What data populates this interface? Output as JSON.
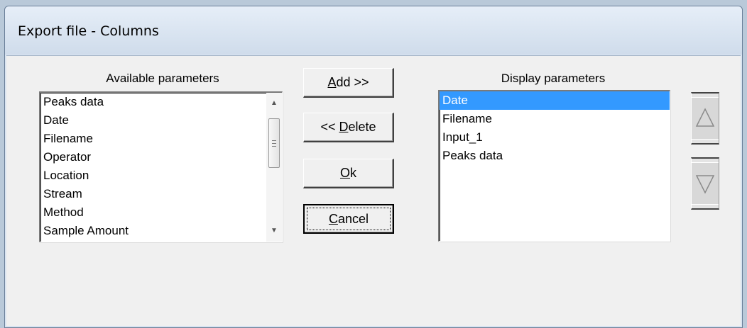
{
  "window": {
    "title": "Export file - Columns"
  },
  "available": {
    "label": "Available parameters",
    "items": [
      "Peaks data",
      "Date",
      "Filename",
      "Operator",
      "Location",
      "Stream",
      "Method",
      "Sample Amount"
    ]
  },
  "display": {
    "label": "Display parameters",
    "items": [
      "Date",
      "Filename",
      "Input_1",
      "Peaks data"
    ],
    "selected": "Date"
  },
  "buttons": {
    "add": {
      "accel": "A",
      "rest": "dd >>"
    },
    "delete": {
      "prefix": "<< ",
      "accel": "D",
      "rest": "elete"
    },
    "ok": {
      "accel": "O",
      "rest": "k"
    },
    "cancel": {
      "accel": "C",
      "rest": "ancel"
    }
  },
  "icons": {
    "move_up": "triangle-up-icon",
    "move_down": "triangle-down-icon",
    "scroll_up": "scroll-up-icon",
    "scroll_down": "scroll-down-icon"
  },
  "colors": {
    "selection": "#3399ff",
    "face": "#f0f0f0"
  }
}
